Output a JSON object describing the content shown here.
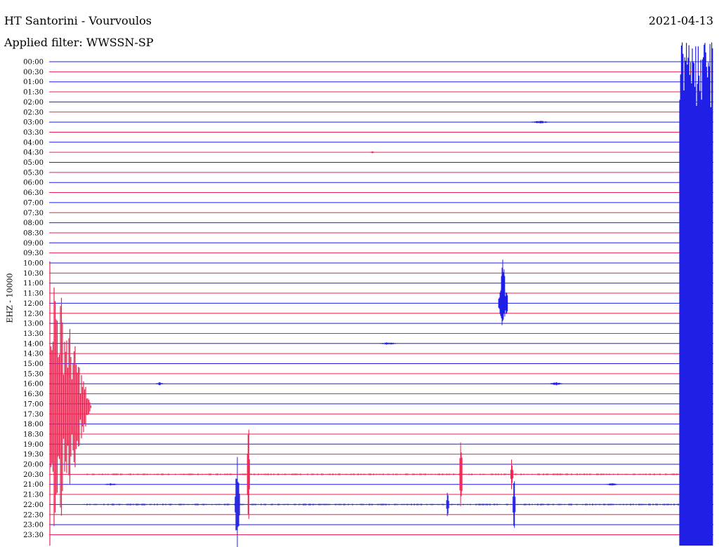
{
  "header": {
    "title": "HT Santorini - Vourvoulos",
    "filter": "Applied filter: WWSSN-SP",
    "date": "2021-04-13"
  },
  "colors": {
    "line_a": "#1f1fe6",
    "line_b": "#ee2250"
  },
  "chart_data": {
    "type": "line",
    "title": "HT Santorini - Vourvoulos",
    "ylabel": "EHZ - 10000",
    "grid": false,
    "legend": "none",
    "y_categories": [
      "00:00",
      "00:30",
      "01:00",
      "01:30",
      "02:00",
      "02:30",
      "03:00",
      "03:30",
      "04:00",
      "04:30",
      "05:00",
      "05:30",
      "06:00",
      "06:30",
      "07:00",
      "07:30",
      "08:00",
      "08:30",
      "09:00",
      "09:30",
      "10:00",
      "10:30",
      "11:00",
      "11:30",
      "12:00",
      "12:30",
      "13:00",
      "13:30",
      "14:00",
      "14:30",
      "15:00",
      "15:30",
      "16:00",
      "16:30",
      "17:00",
      "17:30",
      "18:00",
      "18:30",
      "19:00",
      "19:30",
      "20:00",
      "20:30",
      "21:00",
      "21:30",
      "22:00",
      "22:30",
      "23:00",
      "23:30"
    ],
    "x_range_minutes": [
      0,
      30
    ],
    "events": [
      {
        "row": 6,
        "minute": 22.2,
        "amp": 2,
        "width": 0.8,
        "color": "#1f1fe6"
      },
      {
        "row": 9,
        "minute": 14.6,
        "amp": 1.5,
        "width": 0.2,
        "color": "#ee2250"
      },
      {
        "row": 22,
        "minute": 20.5,
        "amp": 40,
        "width": 0.15,
        "color": "#1f1fe6"
      },
      {
        "row": 24,
        "minute": 20.5,
        "amp": 40,
        "width": 0.4,
        "color": "#1f1fe6"
      },
      {
        "row": 28,
        "minute": 15.3,
        "amp": 2,
        "width": 0.7,
        "color": "#1f1fe6"
      },
      {
        "row": 32,
        "minute": 5.0,
        "amp": 2.5,
        "width": 0.3,
        "color": "#1f1fe6"
      },
      {
        "row": 32,
        "minute": 22.9,
        "amp": 2.5,
        "width": 0.5,
        "color": "#1f1fe6"
      },
      {
        "row": 41,
        "minute": 9.0,
        "amp": 115,
        "width": 0.1,
        "color": "#ee2250"
      },
      {
        "row": 41,
        "minute": 18.6,
        "amp": 85,
        "width": 0.1,
        "color": "#ee2250"
      },
      {
        "row": 41,
        "minute": 20.9,
        "amp": 40,
        "width": 0.1,
        "color": "#ee2250"
      },
      {
        "row": 42,
        "minute": 2.8,
        "amp": 2,
        "width": 0.5,
        "color": "#1f1fe6"
      },
      {
        "row": 42,
        "minute": 25.4,
        "amp": 2,
        "width": 0.5,
        "color": "#1f1fe6"
      },
      {
        "row": 44,
        "minute": 8.5,
        "amp": 70,
        "width": 0.2,
        "color": "#1f1fe6"
      },
      {
        "row": 44,
        "minute": 18.0,
        "amp": 25,
        "width": 0.1,
        "color": "#1f1fe6"
      },
      {
        "row": 44,
        "minute": 21.0,
        "amp": 85,
        "width": 0.1,
        "color": "#1f1fe6"
      }
    ]
  }
}
